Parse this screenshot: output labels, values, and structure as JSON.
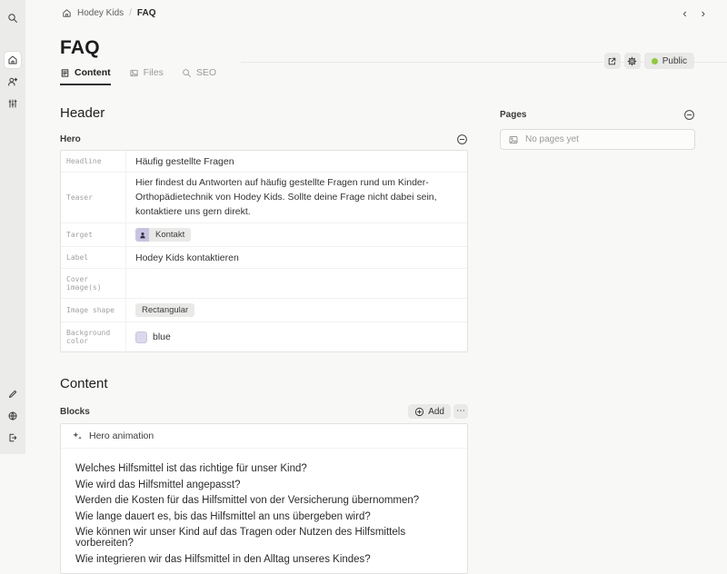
{
  "sidebar": {
    "top_icons": [
      "search-icon"
    ],
    "main_icons": [
      "home-icon",
      "users-icon",
      "sliders-icon"
    ],
    "bottom_icons": [
      "pencil-icon",
      "globe-icon",
      "logout-icon"
    ]
  },
  "breadcrumb": {
    "project": "Hodey Kids",
    "separator": "/",
    "page": "FAQ"
  },
  "nav": {
    "back": "‹",
    "forward": "›"
  },
  "header": {
    "title": "FAQ",
    "status": {
      "label": "Public",
      "dot_color": "#8fc93a"
    }
  },
  "tabs": [
    {
      "label": "Content",
      "active": true
    },
    {
      "label": "Files",
      "active": false
    },
    {
      "label": "SEO",
      "active": false
    }
  ],
  "hero_section": {
    "title": "Header",
    "card_label": "Hero",
    "fields": [
      {
        "label": "Headline",
        "value": "Häufig gestellte Fragen"
      },
      {
        "label": "Teaser",
        "value": "Hier findest du Antworten auf häufig gestellte Fragen rund um Kinder-Orthopädietechnik von Hodey Kids. Sollte deine Frage nicht dabei sein, kontaktiere uns gern direkt."
      },
      {
        "label": "Target",
        "value": "Kontakt"
      },
      {
        "label": "Label",
        "value": "Hodey Kids kontaktieren"
      },
      {
        "label": "Cover image(s)",
        "value": ""
      },
      {
        "label": "Image shape",
        "value": "Rectangular"
      },
      {
        "label": "Background color",
        "value": "blue",
        "swatch": "#dbd8ed"
      }
    ]
  },
  "content_section": {
    "title": "Content",
    "card_label": "Blocks",
    "add_label": "Add",
    "more_label": "⋯",
    "block_item": "Hero animation",
    "questions": [
      "Welches Hilfsmittel ist das richtige für unser Kind?",
      "Wie wird das Hilfsmittel angepasst?",
      "Werden die Kosten für das Hilfsmittel von der Versicherung übernommen?",
      "Wie lange dauert es, bis das Hilfsmittel an uns übergeben wird?",
      "Wie können wir unser Kind auf das Tragen oder Nutzen des Hilfsmittels vorbereiten?",
      "Wie integrieren wir das Hilfsmittel in den Alltag unseres Kindes?"
    ]
  },
  "pages_panel": {
    "title": "Pages",
    "empty_text": "No pages yet"
  },
  "colors": {
    "status_green": "#8fc93a",
    "avatar_purple": "#c9c3e2",
    "swatch_blue": "#dbd8ed",
    "sidebar_bg": "#ebebea"
  }
}
